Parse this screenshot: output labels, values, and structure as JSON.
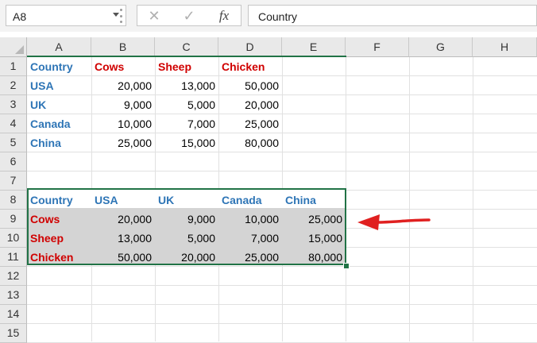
{
  "formula_bar": {
    "name_box": "A8",
    "formula": "Country",
    "fx_label": "fx"
  },
  "columns": [
    "A",
    "B",
    "C",
    "D",
    "E",
    "F",
    "G",
    "H"
  ],
  "rows": [
    "1",
    "2",
    "3",
    "4",
    "5",
    "6",
    "7",
    "8",
    "9",
    "10",
    "11",
    "12",
    "13",
    "14",
    "15"
  ],
  "table1": {
    "header": [
      "Country",
      "Cows",
      "Sheep",
      "Chicken"
    ],
    "rows": [
      [
        "USA",
        "20,000",
        "13,000",
        "50,000"
      ],
      [
        "UK",
        "9,000",
        "5,000",
        "20,000"
      ],
      [
        "Canada",
        "10,000",
        "7,000",
        "25,000"
      ],
      [
        "China",
        "25,000",
        "15,000",
        "80,000"
      ]
    ]
  },
  "table2": {
    "header": [
      "Country",
      "USA",
      "UK",
      "Canada",
      "China"
    ],
    "rows": [
      [
        "Cows",
        "20,000",
        "9,000",
        "10,000",
        "25,000"
      ],
      [
        "Sheep",
        "13,000",
        "5,000",
        "7,000",
        "15,000"
      ],
      [
        "Chicken",
        "50,000",
        "20,000",
        "25,000",
        "80,000"
      ]
    ]
  },
  "colors": {
    "header_blue": "#2e75b6",
    "header_red": "#d00000",
    "selection_green": "#217346",
    "arrow_red": "#e02020"
  }
}
